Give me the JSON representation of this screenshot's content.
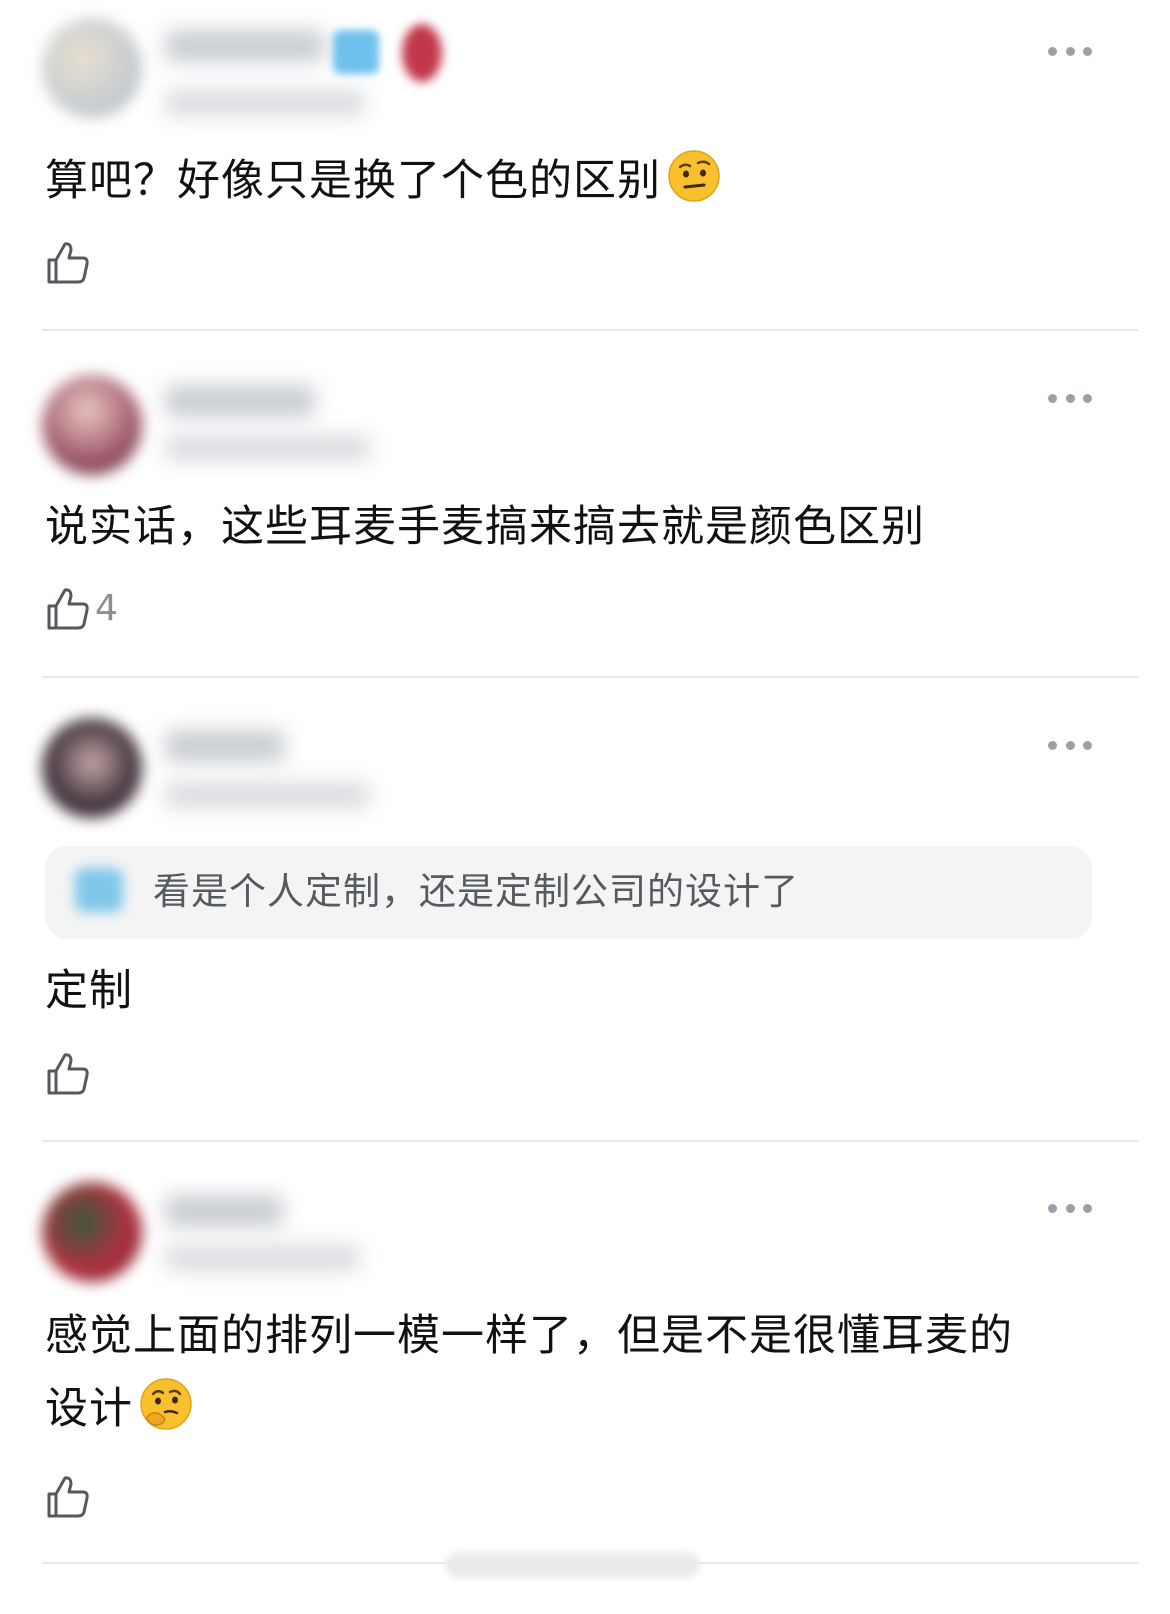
{
  "comments": [
    {
      "text": "算吧？好像只是换了个色的区别",
      "emoji": "raised-eyebrow-emoji",
      "like_count": "",
      "avatar_color": "#cdd4d8"
    },
    {
      "text": "说实话，这些耳麦手麦搞来搞去就是颜色区别",
      "emoji": "",
      "like_count": "4",
      "avatar_color": "#8a4a55"
    },
    {
      "text": "定制",
      "emoji": "",
      "like_count": "",
      "quote": "看是个人定制，还是定制公司的设计了",
      "avatar_color": "#3c3038"
    },
    {
      "text_line1": "感觉上面的排列一模一样了，但是不是很懂耳麦的",
      "text_line2": "设计",
      "emoji": "thinking-face-emoji",
      "like_count": "",
      "avatar_color": "#b03040"
    }
  ],
  "colors": {
    "text": "#111111",
    "secondary_text": "#555a60",
    "icon_gray": "#9aa0a6",
    "divider": "#e8e8e8",
    "quote_bg": "#f4f4f5",
    "emoji_yellow": "#f7c02c"
  },
  "icons": {
    "more": "more-dots-icon",
    "like": "thumbs-up-icon"
  }
}
